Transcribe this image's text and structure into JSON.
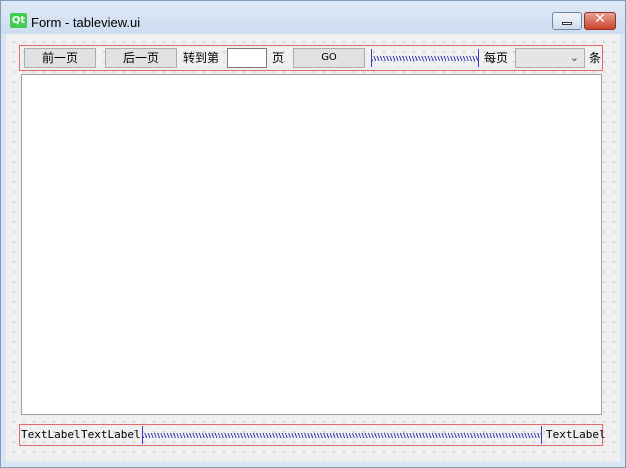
{
  "window": {
    "title": "Form - tableview.ui",
    "logo_text": "Qt",
    "minimize_icon": "minimize-icon",
    "close_icon": "close-icon",
    "close_glyph": "✕"
  },
  "pager": {
    "prev_label": "前一页",
    "next_label": "后一页",
    "goto_prefix": "转到第",
    "page_input_value": "",
    "page_suffix": "页",
    "go_label": "GO",
    "per_page_prefix": "每页",
    "per_page_selected": "",
    "per_page_suffix": "条"
  },
  "status": {
    "label_1": "TextLabel",
    "label_2": "TextLabel",
    "label_3": "TextLabel"
  },
  "colors": {
    "layout_border": "#e26a6a",
    "spacer": "#3b3bb5",
    "qt_green": "#41cd52"
  }
}
